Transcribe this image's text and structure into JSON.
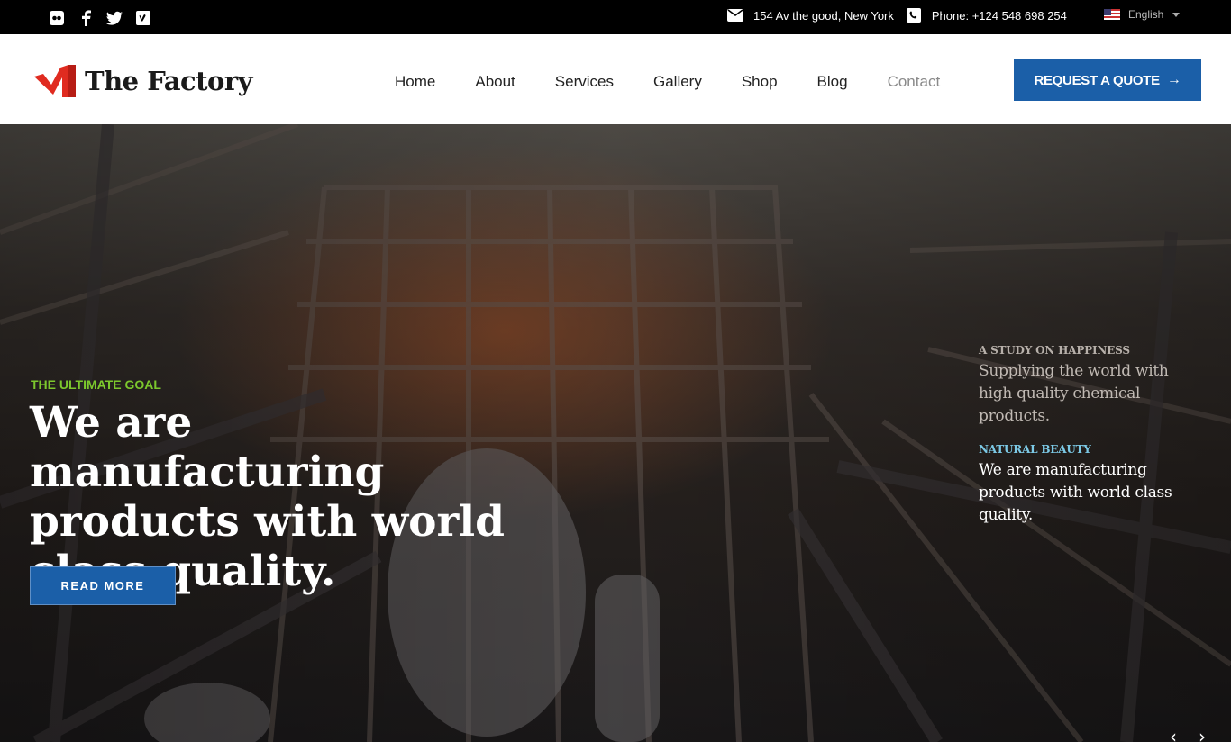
{
  "topbar": {
    "social": [
      "flickr-icon",
      "facebook-icon",
      "twitter-icon",
      "vimeo-icon"
    ],
    "address": "154 Av the good, New York",
    "phone": "Phone: +124 548 698 254",
    "language": "English"
  },
  "header": {
    "logo_text": "The Factory",
    "nav": [
      "Home",
      "About",
      "Services",
      "Gallery",
      "Shop",
      "Blog",
      "Contact"
    ],
    "active_nav": "Contact",
    "quote_button": "REQUEST A QUOTE",
    "quote_arrow": "→"
  },
  "hero": {
    "kicker": "THE ULTIMATE GOAL",
    "headline": "We are manufacturing products with world class quality.",
    "read_more": "READ MORE",
    "side_items": [
      {
        "label": "A STUDY ON HAPPINESS",
        "text": "Supplying the world with high quality chemical products."
      },
      {
        "label": "NATURAL BEAUTY",
        "text": "We are manufacturing products with world class quality."
      }
    ],
    "prev_arrow": "‹",
    "next_arrow": "›"
  },
  "colors": {
    "brand_blue": "#1b5fa8",
    "accent_green": "#7cc82d",
    "logo_red": "#e02b20",
    "label_cyan": "#7cc9e6"
  }
}
